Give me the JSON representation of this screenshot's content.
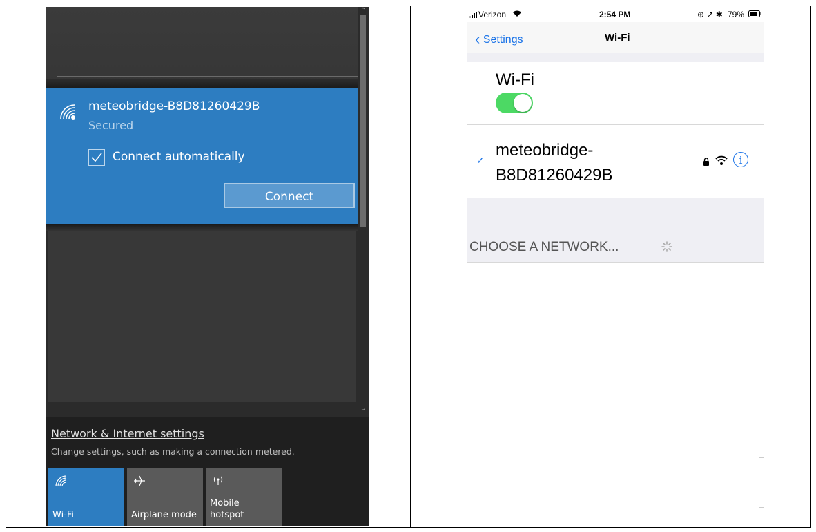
{
  "windows_panel": {
    "network": {
      "ssid": "meteobridge-B8D81260429B",
      "status": "Secured",
      "auto_connect_label": "Connect automatically",
      "auto_connect_checked": true,
      "connect_label": "Connect"
    },
    "settings_link": "Network & Internet settings",
    "settings_subtext": "Change settings, such as making a connection metered.",
    "tiles": [
      {
        "label": "Wi-Fi",
        "icon": "wifi-icon",
        "active": true
      },
      {
        "label": "Airplane mode",
        "icon": "airplane-icon",
        "active": false
      },
      {
        "label_line1": "Mobile",
        "label_line2": "hotspot",
        "icon": "hotspot-icon",
        "active": false
      }
    ],
    "colors": {
      "accent": "#2d7dc1",
      "background": "#2b2b2b"
    }
  },
  "ios_panel": {
    "status_bar": {
      "carrier": "Verizon",
      "time": "2:54 PM",
      "battery": "79%"
    },
    "nav": {
      "back_label": "Settings",
      "title": "Wi-Fi"
    },
    "wifi_label": "Wi-Fi",
    "wifi_enabled": true,
    "connected_network": {
      "name_line1": "meteobridge-",
      "name_line2": "B8D81260429B"
    },
    "choose_label": "CHOOSE A NETWORK...",
    "info_glyph": "i",
    "colors": {
      "tint": "#1a73e8",
      "toggle_on": "#4cd964"
    }
  }
}
